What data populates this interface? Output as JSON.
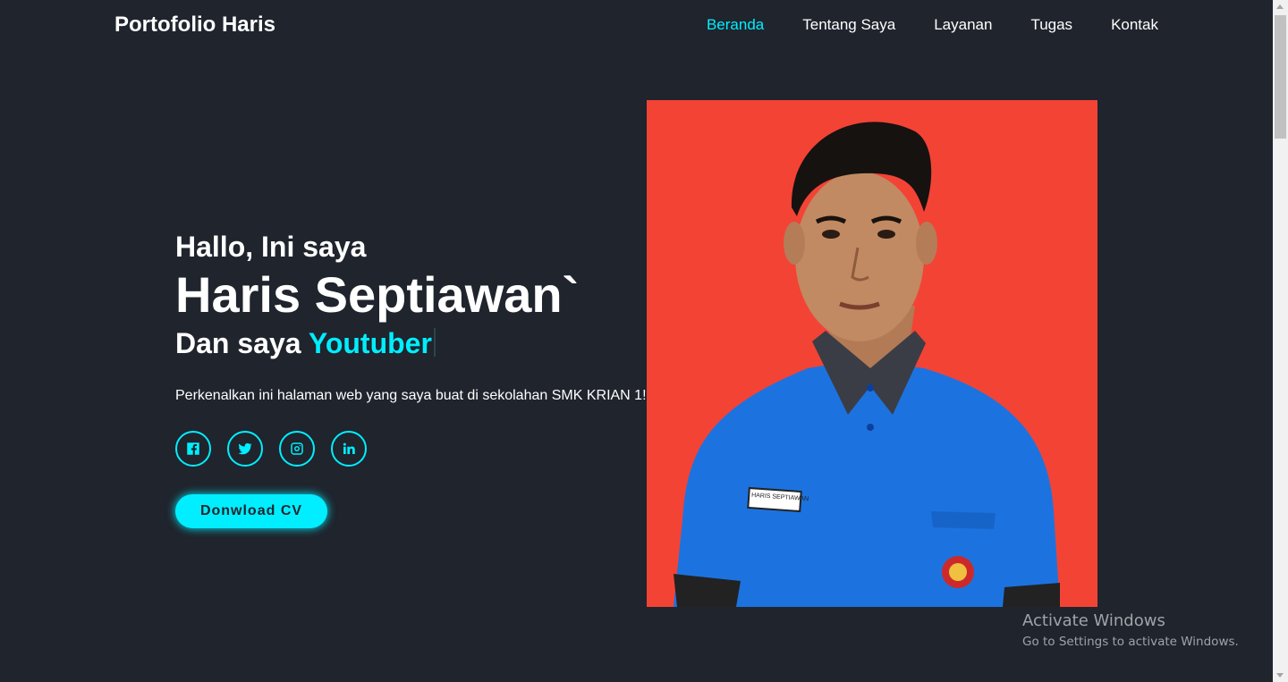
{
  "header": {
    "logo": "Portofolio Haris",
    "nav": [
      {
        "label": "Beranda",
        "active": true
      },
      {
        "label": "Tentang Saya",
        "active": false
      },
      {
        "label": "Layanan",
        "active": false
      },
      {
        "label": "Tugas",
        "active": false
      },
      {
        "label": "Kontak",
        "active": false
      }
    ]
  },
  "home": {
    "greeting": "Hallo, Ini saya",
    "name": "Haris Septiawan`",
    "role_prefix": "Dan saya",
    "role": "Youtuber",
    "intro": "Perkenalkan ini halaman web yang saya buat di sekolahan SMK KRIAN 1!",
    "socials": [
      "facebook-icon",
      "twitter-icon",
      "instagram-icon",
      "linkedin-icon"
    ],
    "cv_button": "Donwload CV"
  },
  "photo": {
    "badge_text": "HARIS SEPTIAWAN"
  },
  "watermark": {
    "line1": "Activate Windows",
    "line2": "Go to Settings to activate Windows."
  },
  "colors": {
    "background": "#1f242d",
    "accent": "#00eeff",
    "photo_bg": "#f34335"
  }
}
